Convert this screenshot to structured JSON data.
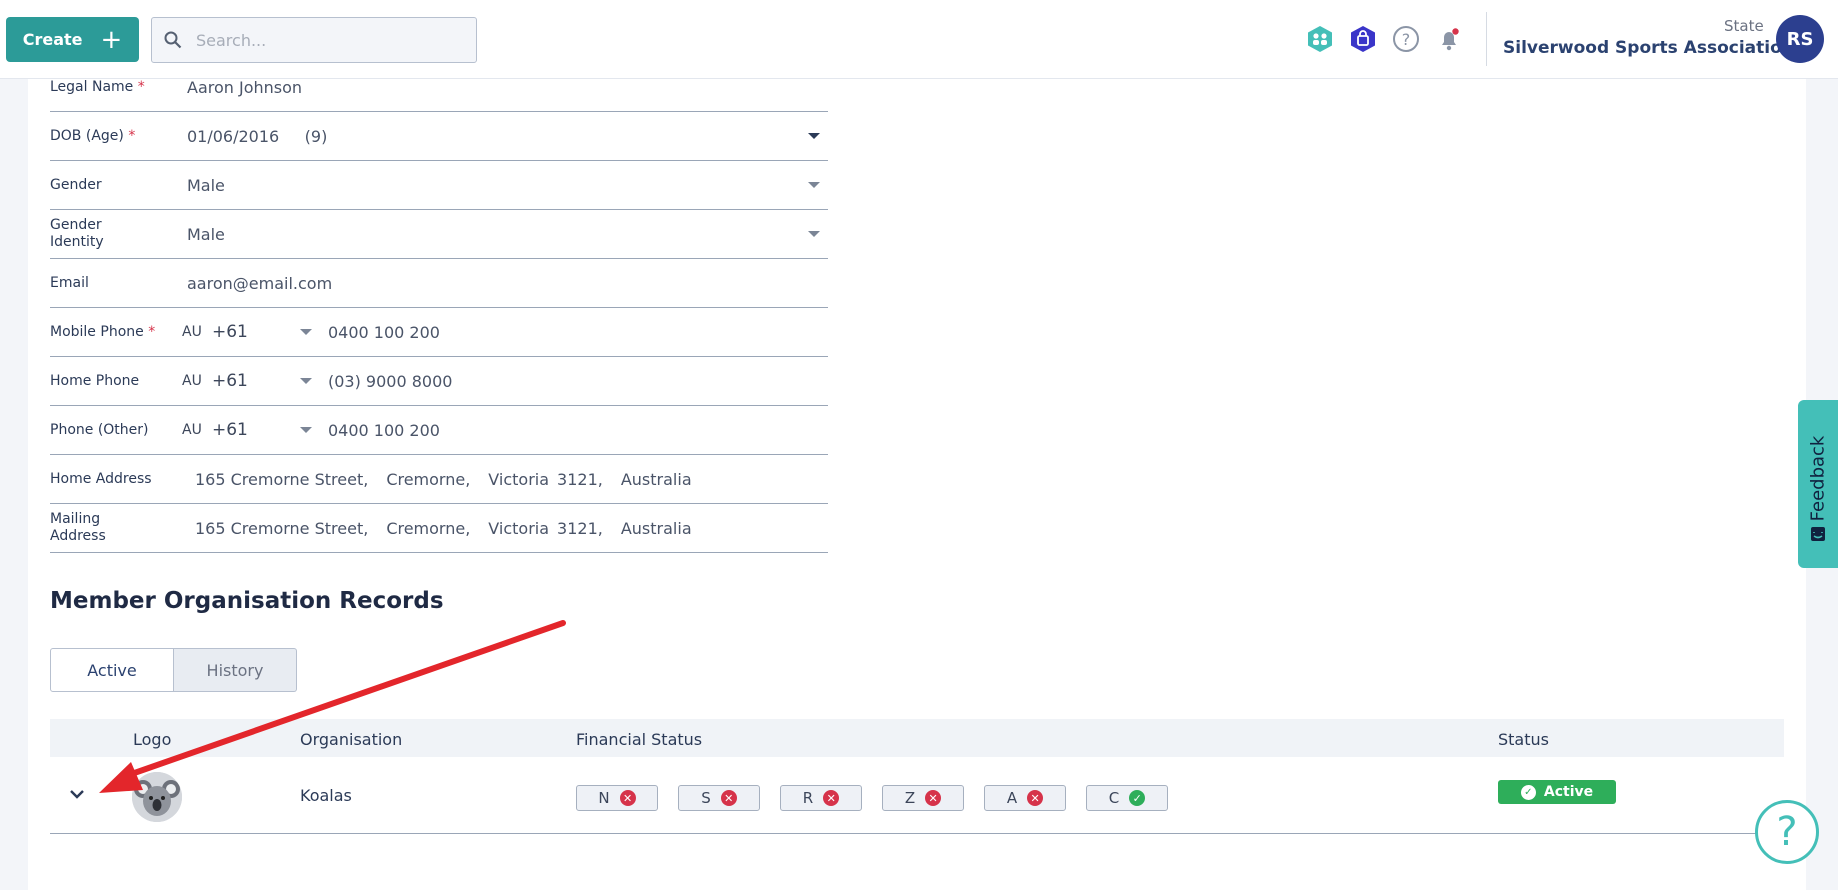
{
  "header": {
    "create_label": "Create",
    "search_placeholder": "Search...",
    "state_label": "State",
    "org_name": "Silverwood Sports Association",
    "avatar_initials": "RS",
    "accent_color": "#2c9b98"
  },
  "form": {
    "legal_name": {
      "label": "Legal Name",
      "req": "*",
      "value": "Aaron Johnson"
    },
    "dob": {
      "label": "DOB (Age)",
      "req": "*",
      "value": "01/06/2016",
      "age": "(9)"
    },
    "gender": {
      "label": "Gender",
      "value": "Male"
    },
    "gender_identity": {
      "label": "Gender Identity",
      "value": "Male"
    },
    "email": {
      "label": "Email",
      "value": "aaron@email.com"
    },
    "mobile_phone": {
      "label": "Mobile Phone",
      "req": "*",
      "cc": "AU",
      "dial": "+61",
      "value": "0400 100 200"
    },
    "home_phone": {
      "label": "Home Phone",
      "cc": "AU",
      "dial": "+61",
      "value": "(03) 9000 8000"
    },
    "other_phone": {
      "label": "Phone (Other)",
      "cc": "AU",
      "dial": "+61",
      "value": "0400 100 200"
    },
    "home_address": {
      "label": "Home Address",
      "street": "165 Cremorne Street,",
      "suburb": "Cremorne,",
      "state": "Victoria",
      "postcode": "3121,",
      "country": "Australia"
    },
    "mailing_address": {
      "label": "Mailing Address",
      "street": "165 Cremorne Street,",
      "suburb": "Cremorne,",
      "state": "Victoria",
      "postcode": "3121,",
      "country": "Australia"
    }
  },
  "records": {
    "title": "Member Organisation Records",
    "tabs": [
      "Active",
      "History"
    ],
    "columns": {
      "logo": "Logo",
      "organisation": "Organisation",
      "financial": "Financial Status",
      "status": "Status"
    },
    "rows": [
      {
        "organisation": "Koalas",
        "financial": [
          {
            "code": "N",
            "ok": false
          },
          {
            "code": "S",
            "ok": false
          },
          {
            "code": "R",
            "ok": false
          },
          {
            "code": "Z",
            "ok": false
          },
          {
            "code": "A",
            "ok": false
          },
          {
            "code": "C",
            "ok": true
          }
        ],
        "status": "Active"
      }
    ]
  },
  "feedback_label": "Feedback",
  "help_glyph": "?"
}
